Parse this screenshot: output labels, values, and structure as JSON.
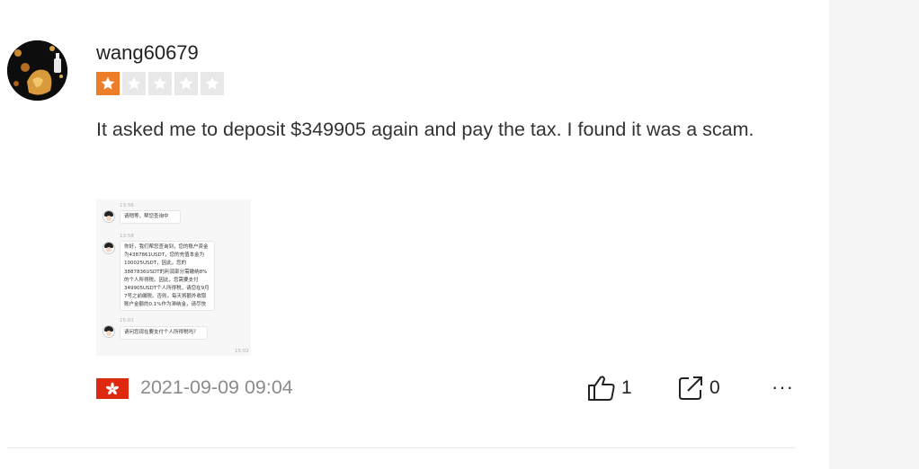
{
  "review": {
    "username": "wang60679",
    "rating": 1,
    "rating_max": 5,
    "text": "It asked me to deposit $349905 again and pay the tax. I found it was a scam.",
    "date": "2021-09-09 09:04",
    "flag_icon": "hong-kong-flag-icon",
    "likes": "1",
    "shares": "0",
    "more_label": "···"
  },
  "screenshot": {
    "ts1": "13:56",
    "msg1": "请稍等，帮您查询中",
    "ts2": "13:58",
    "msg2": "你好，我们帮您查询到，您的账户资金为4387861USDT，您的充值本金为100025USDT，因此，您的3887836USDT的利润部分需缴纳8%的个人所得税。因此，您需要支付349905USDT个人所得税，请您在9月7号之前缴税。否则，每天将额外收取账户金额的0.1%作为滞纳金，请尽快付款。这样我们就可以为您释放资金，谢谢！",
    "ts3": "15:01",
    "msg3": "请问您现在要支付个人所得税吗？",
    "ts4": "15:02"
  },
  "colors": {
    "star_filled": "#ee7d29",
    "star_empty": "#e8e8e8",
    "flag_red": "#de2910",
    "date_gray": "#8c8c8c"
  }
}
